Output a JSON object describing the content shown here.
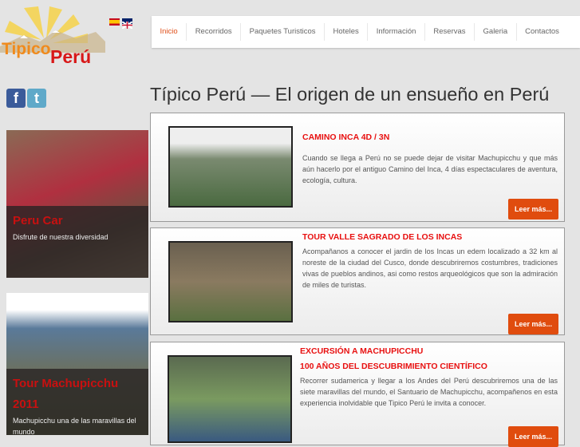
{
  "logo": {
    "text1": "Tipico",
    "text2": "Perú"
  },
  "languages": [
    {
      "name": "Español",
      "icon": "spain-flag-icon"
    },
    {
      "name": "English",
      "icon": "uk-flag-icon"
    }
  ],
  "nav": {
    "items": [
      "Inicio",
      "Recorridos",
      "Paquetes Turisticos",
      "Hoteles",
      "Información",
      "Reservas",
      "Galeria",
      "Contactos"
    ],
    "active": 0
  },
  "social": {
    "facebook": "f",
    "twitter": "t"
  },
  "page_title": "Típico Perú — El origen de un ensueño en Perú",
  "sidebar": [
    {
      "title": "Peru Car",
      "subtitle": "Disfrute de nuestra diversidad"
    },
    {
      "title": "Tour Machupicchu 2011",
      "subtitle": "Machupicchu una de las maravillas del mundo"
    }
  ],
  "cards": [
    {
      "title": "CAMINO INCA 4D / 3N",
      "text": "Cuando se llega a Perú no se puede dejar de visitar Machupicchu y que más aún hacerlo por el antiguo Camino del Inca, 4  días espectaculares de aventura, ecología, cultura.",
      "button": "Leer más..."
    },
    {
      "title": "TOUR VALLE SAGRADO DE LOS INCAS",
      "text": "Acompañanos a conocer el jardin de los Incas un edem localizado a 32 km al noreste de la ciudad del Cusco, donde descubriremos costumbres, tradiciones vivas de pueblos andinos, asi como restos arqueológicos  que son la admiración de miles de turistas.",
      "button": "Leer más..."
    },
    {
      "title": "EXCURSIÓN A MACHUPICCHU",
      "title2": "100 AÑOS DEL DESCUBRIMIENTO CIENTÍFICO",
      "text": "Recorrer sudamerica y llegar a los Andes del Perú descubriremos una de las siete maravillas del mundo, el Santuario de Machupicchu,  acompañenos en esta experiencia inolvidable que Tipico Perú le invita a conocer.",
      "button": "Leer más..."
    }
  ],
  "colors": {
    "accent": "#e04c0e",
    "title_red": "#e81010",
    "background": "#e4e4e4"
  }
}
